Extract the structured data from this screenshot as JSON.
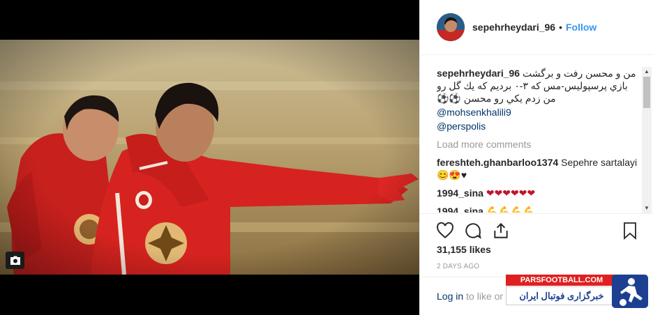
{
  "post": {
    "username": "sepehrheydari_96",
    "separator": "•",
    "follow_label": "Follow",
    "caption_user": "sepehrheydari_96",
    "caption_text": "من و محسن رفت و برگشت بازي پرسپوليس-مس كه ٣-٠ برديم كه يك گل رو من زدم يكي رو محسن ⚽⚽",
    "mentions": [
      "@mohsenkhalili9",
      "@perspolis"
    ],
    "load_more": "Load more comments",
    "comments": [
      {
        "user": "fereshteh.ghanbarloo1374",
        "text": "Sepehre sartalayi😊😍♥"
      },
      {
        "user": "1994_sina",
        "text": "❤❤❤❤❤❤"
      },
      {
        "user": "1994_sina",
        "text": "💪💪💪💪"
      }
    ],
    "likes": "31,155 likes",
    "date": "2 DAYS AGO",
    "login_label": "Log in",
    "login_suffix": "to like or"
  },
  "icons": {
    "like": "heart-icon",
    "comment": "comment-icon",
    "share": "share-icon",
    "save": "bookmark-icon",
    "media": "camera-icon"
  },
  "watermark": {
    "site": "PARSFOOTBALL.COM",
    "tagline": "خبرگزاری فوتبال ایران"
  },
  "colors": {
    "link": "#003569",
    "follow": "#3897f0",
    "muted": "#999999",
    "jersey": "#d3221f"
  }
}
